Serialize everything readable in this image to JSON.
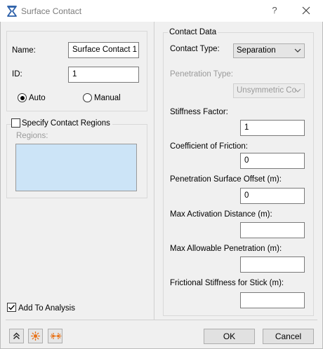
{
  "window": {
    "title": "Surface Contact",
    "help_glyph": "?",
    "icons": {
      "app": "surface-contact-app-icon",
      "close": "close-icon"
    }
  },
  "left": {
    "name_label": "Name:",
    "name_value": "Surface Contact 1",
    "id_label": "ID:",
    "id_value": "1",
    "auto_label": "Auto",
    "manual_label": "Manual",
    "id_mode_selected": "Auto",
    "specify_regions_label": "Specify Contact Regions",
    "specify_regions_checked": false,
    "regions_label": "Regions:",
    "add_to_analysis_label": "Add To Analysis",
    "add_to_analysis_checked": true
  },
  "right": {
    "group_title": "Contact Data",
    "contact_type_label": "Contact Type:",
    "contact_type_value": "Separation",
    "penetration_type_label": "Penetration Type:",
    "penetration_type_value": "Unsymmetric Co",
    "stiffness_label": "Stiffness Factor:",
    "stiffness_value": "1",
    "friction_label": "Coefficient of Friction:",
    "friction_value": "0",
    "offset_label": "Penetration Surface Offset (m):",
    "offset_value": "0",
    "activation_label": "Max Activation Distance (m):",
    "activation_value": "",
    "penetration_label": "Max Allowable Penetration (m):",
    "penetration_value": "",
    "frictional_stiffness_label": "Frictional Stiffness for Stick (m):",
    "frictional_stiffness_value": ""
  },
  "footer": {
    "ok_label": "OK",
    "cancel_label": "Cancel",
    "icons": [
      "collapse-up-icon",
      "sun-icon",
      "sun-multiple-icon"
    ]
  },
  "colors": {
    "regions_fill": "#cce4f7",
    "icon_orange": "#e8731a"
  }
}
